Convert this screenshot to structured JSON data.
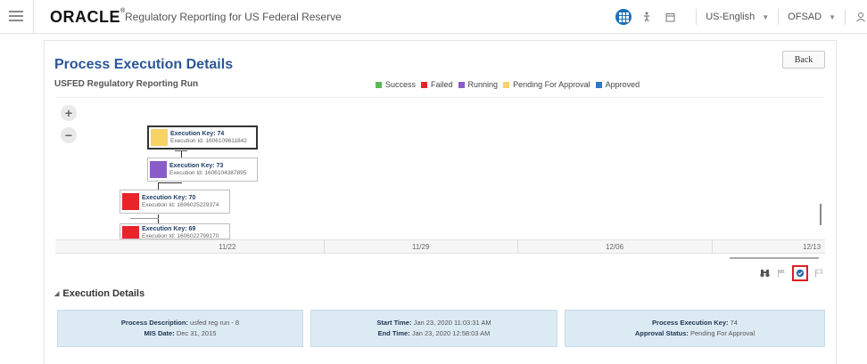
{
  "header": {
    "logo": "ORACLE",
    "logo_mark": "®",
    "app_title": "Regulatory Reporting for US Federal Reserve",
    "language": "US-English",
    "user": "OFSAD",
    "icons": [
      "hamburger-icon",
      "app-grid-icon",
      "accessibility-icon",
      "calendar-icon",
      "user-icon"
    ]
  },
  "page": {
    "title": "Process Execution Details",
    "run_name": "USFED Regulatory Reporting Run",
    "back_label": "Back"
  },
  "legend": [
    {
      "label": "Success",
      "color": "#5cb85c"
    },
    {
      "label": "Failed",
      "color": "#e8232a"
    },
    {
      "label": "Running",
      "color": "#8a5cc7"
    },
    {
      "label": "Pending For Approval",
      "color": "#f7d264"
    },
    {
      "label": "Approved",
      "color": "#2c79c7"
    }
  ],
  "diagram": {
    "zoom_in": "+",
    "zoom_out": "−",
    "nodes": [
      {
        "key_label": "Execution Key: 74",
        "id_label": "Execution Id: 1606109611842",
        "status": "Pending For Approval",
        "color": "#f7d264",
        "selected": true
      },
      {
        "key_label": "Execution Key: 73",
        "id_label": "Execution Id: 1606104387895",
        "status": "Running",
        "color": "#8a5cc7",
        "selected": false
      },
      {
        "key_label": "Execution Key: 70",
        "id_label": "Execution Id: 1606025229374",
        "status": "Failed",
        "color": "#e8232a",
        "selected": false
      },
      {
        "key_label": "Execution Key: 69",
        "id_label": "Execution Id: 1606022799170",
        "status": "Failed",
        "color": "#e8232a",
        "selected": false
      }
    ],
    "timeline": [
      "11/22",
      "11/29",
      "12/06",
      "12/13"
    ]
  },
  "execution_details": {
    "section_title": "Execution Details",
    "cards": [
      {
        "rows": [
          {
            "label": "Process Description:",
            "value": "usfed reg run - 8"
          },
          {
            "label": "MIS Date:",
            "value": "Dec 31, 2015"
          }
        ]
      },
      {
        "rows": [
          {
            "label": "Start Time:",
            "value": "Jan 23, 2020 11:03:31 AM"
          },
          {
            "label": "End Time:",
            "value": "Jan 23, 2020 12:58:03 AM"
          }
        ]
      },
      {
        "rows": [
          {
            "label": "Process Execution Key:",
            "value": "74"
          },
          {
            "label": "Approval Status:",
            "value": "Pending For Approval"
          }
        ]
      }
    ]
  },
  "toolbar_icons": [
    "binoculars-icon",
    "flag-icon",
    "approve-icon",
    "flag-outline-icon"
  ]
}
